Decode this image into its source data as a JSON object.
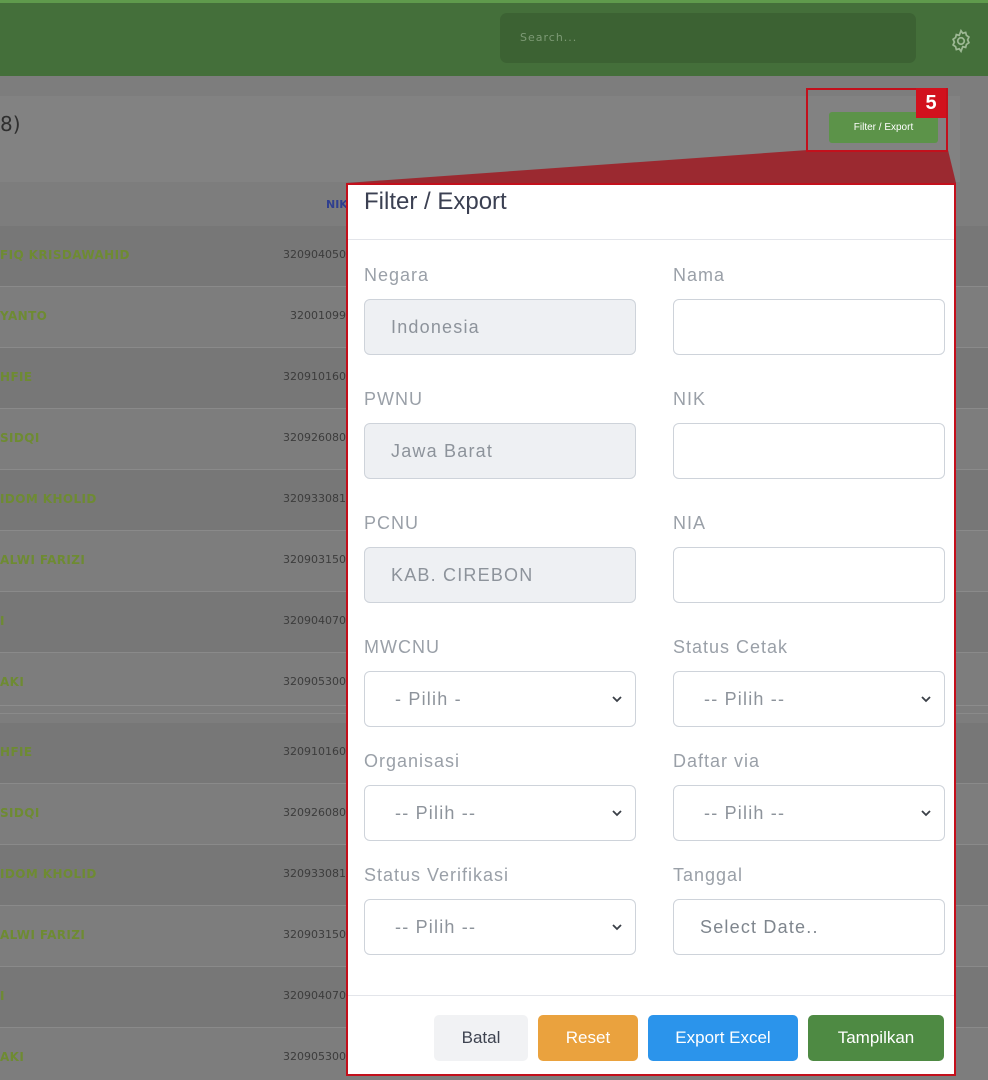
{
  "topbar": {
    "search_placeholder": "Search...",
    "settings_icon": "gear-icon"
  },
  "page": {
    "title_fragment": "8)",
    "col_nik": "NIK",
    "rows": [
      {
        "name": "FIQ KRISDAWAHID",
        "nik": "320904050"
      },
      {
        "name": "YANTO",
        "nik": "32001099"
      },
      {
        "name": "HFIE",
        "nik": "320910160"
      },
      {
        "name": "SIDQI",
        "nik": "320926080"
      },
      {
        "name": "IDOM KHOLID",
        "nik": "320933081"
      },
      {
        "name": "ALWI FARIZI",
        "nik": "320903150"
      },
      {
        "name": "I",
        "nik": "320904070"
      },
      {
        "name": "AKI",
        "nik": "320905300"
      },
      {
        "name": "HFIE",
        "nik": "320910160"
      },
      {
        "name": "SIDQI",
        "nik": "320926080"
      },
      {
        "name": "IDOM KHOLID",
        "nik": "320933081"
      },
      {
        "name": "ALWI FARIZI",
        "nik": "320903150"
      },
      {
        "name": "I",
        "nik": "320904070"
      },
      {
        "name": "AKI",
        "nik": "320905300"
      }
    ]
  },
  "highlight": {
    "number": "5",
    "button_label": "Filter / Export",
    "color": "#c3101c"
  },
  "modal": {
    "title": "Filter / Export",
    "fields": {
      "negara": {
        "label": "Negara",
        "value": "Indonesia"
      },
      "nama": {
        "label": "Nama",
        "value": ""
      },
      "pwnu": {
        "label": "PWNU",
        "value": "Jawa Barat"
      },
      "nik": {
        "label": "NIK",
        "value": ""
      },
      "pcnu": {
        "label": "PCNU",
        "value": "KAB. CIREBON"
      },
      "nia": {
        "label": "NIA",
        "value": ""
      },
      "mwcnu": {
        "label": "MWCNU",
        "value": "- Pilih -"
      },
      "status_cetak": {
        "label": "Status Cetak",
        "value": "-- Pilih --"
      },
      "organisasi": {
        "label": "Organisasi",
        "value": "-- Pilih --"
      },
      "daftar_via": {
        "label": "Daftar via",
        "value": "-- Pilih --"
      },
      "status_verifikasi": {
        "label": "Status Verifikasi",
        "value": "-- Pilih --"
      },
      "tanggal": {
        "label": "Tanggal",
        "placeholder": "Select Date.."
      }
    },
    "buttons": {
      "batal": "Batal",
      "reset": "Reset",
      "export": "Export Excel",
      "tampilkan": "Tampilkan"
    }
  },
  "colors": {
    "topbar": "#446f3a",
    "reset": "#eaa23e",
    "export": "#2b94eb",
    "tampilkan": "#4e8a43"
  }
}
